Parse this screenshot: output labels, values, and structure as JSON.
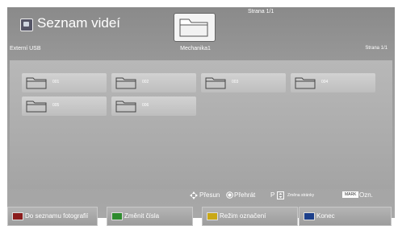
{
  "header": {
    "title": "Seznam videí",
    "page_top": "Strana 1/1",
    "source": "Externí USB",
    "device": "Mechanika1",
    "page_right": "Strana 1/1"
  },
  "folders": [
    {
      "name": "001"
    },
    {
      "name": "002"
    },
    {
      "name": "003"
    },
    {
      "name": "004"
    },
    {
      "name": "005"
    },
    {
      "name": "006"
    }
  ],
  "hints": {
    "move": "Přesun",
    "play": "Přehrát",
    "page_key": "P",
    "page_change": "Změna stránky",
    "mark_key": "MARK",
    "mark_label": "Ozn."
  },
  "buttons": [
    {
      "label": "Do seznamu fotografií",
      "color": "#8a1c1c"
    },
    {
      "label": "Změnit čísla",
      "color": "#2e8b2e"
    },
    {
      "label": "Režim označení",
      "color": "#c9a816"
    },
    {
      "label": "Konec",
      "color": "#1c3f8a"
    }
  ],
  "icons": {
    "app": "video-list-icon",
    "device": "folder-icon",
    "move": "navigate-arrows-icon",
    "play": "ok-button-icon",
    "page": "page-updown-icon"
  }
}
